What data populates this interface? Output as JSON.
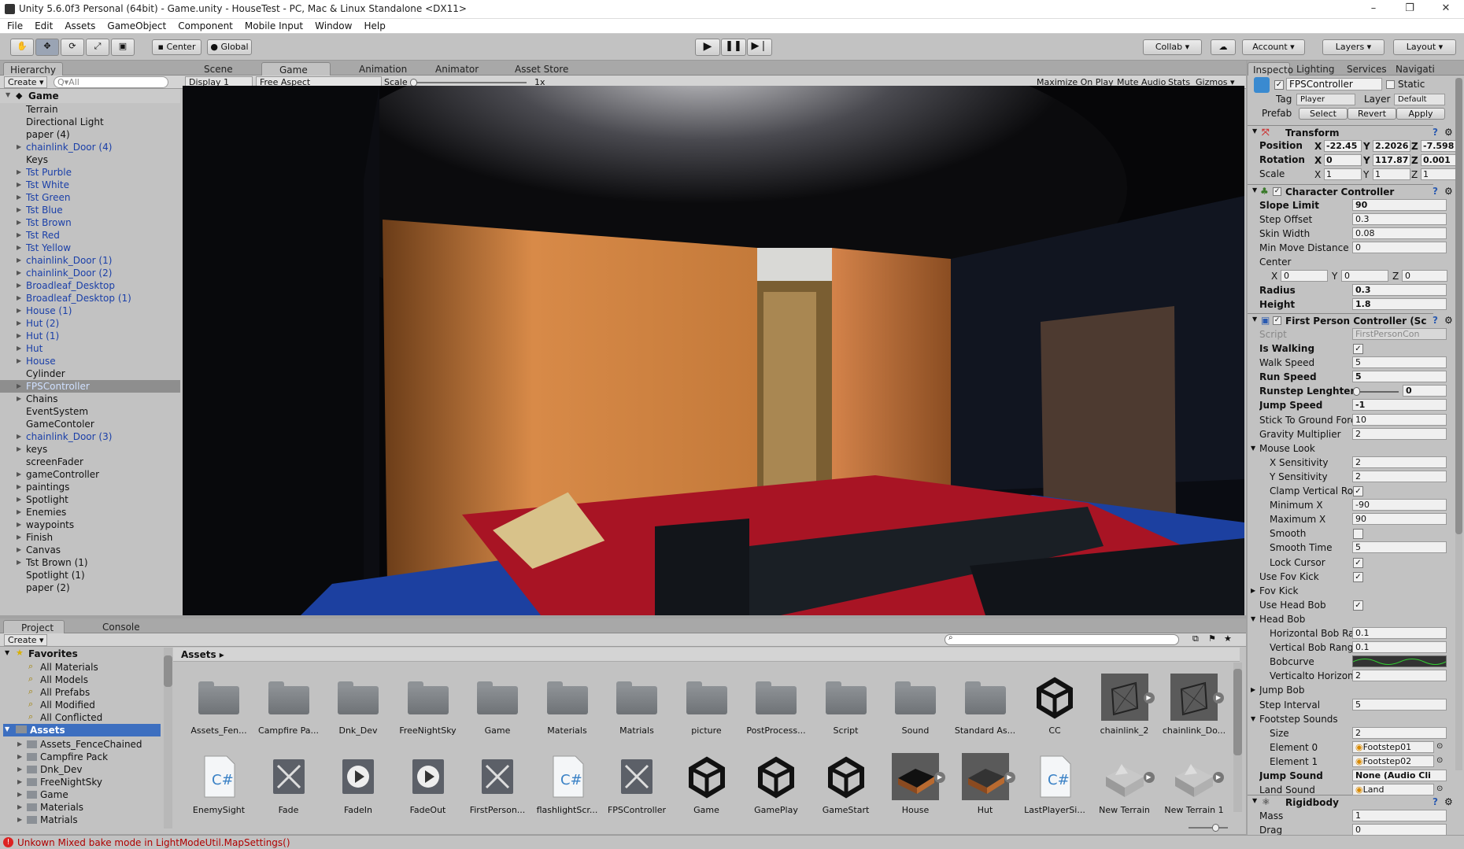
{
  "window": {
    "title": "Unity 5.6.0f3 Personal (64bit) - Game.unity - HouseTest - PC, Mac & Linux Standalone <DX11>",
    "min": "–",
    "max": "❐",
    "close": "✕"
  },
  "menu": [
    "File",
    "Edit",
    "Assets",
    "GameObject",
    "Component",
    "Mobile Input",
    "Window",
    "Help"
  ],
  "toolbar": {
    "center": "Center",
    "global": "Global",
    "collab": "Collab ▾",
    "account": "Account",
    "layers": "Layers",
    "layout": "Layout"
  },
  "hierarchy": {
    "tab": "Hierarchy",
    "create": "Create ▾",
    "search_placeholder": "Q▾All",
    "scene": "Game",
    "items": [
      {
        "label": "Terrain",
        "prefab": false,
        "arrow": false
      },
      {
        "label": "Directional Light",
        "prefab": false,
        "arrow": false
      },
      {
        "label": "paper (4)",
        "prefab": false,
        "arrow": false
      },
      {
        "label": "chainlink_Door (4)",
        "prefab": true,
        "arrow": true
      },
      {
        "label": "Keys",
        "prefab": false,
        "arrow": false
      },
      {
        "label": "Tst Purble",
        "prefab": true,
        "arrow": true
      },
      {
        "label": "Tst White",
        "prefab": true,
        "arrow": true
      },
      {
        "label": "Tst Green",
        "prefab": true,
        "arrow": true
      },
      {
        "label": "Tst Blue",
        "prefab": true,
        "arrow": true
      },
      {
        "label": "Tst Brown",
        "prefab": true,
        "arrow": true
      },
      {
        "label": "Tst Red",
        "prefab": true,
        "arrow": true
      },
      {
        "label": "Tst Yellow",
        "prefab": true,
        "arrow": true
      },
      {
        "label": "chainlink_Door (1)",
        "prefab": true,
        "arrow": true
      },
      {
        "label": "chainlink_Door (2)",
        "prefab": true,
        "arrow": true
      },
      {
        "label": "Broadleaf_Desktop",
        "prefab": true,
        "arrow": true
      },
      {
        "label": "Broadleaf_Desktop (1)",
        "prefab": true,
        "arrow": true
      },
      {
        "label": "House (1)",
        "prefab": true,
        "arrow": true
      },
      {
        "label": "Hut (2)",
        "prefab": true,
        "arrow": true
      },
      {
        "label": "Hut (1)",
        "prefab": true,
        "arrow": true
      },
      {
        "label": "Hut",
        "prefab": true,
        "arrow": true
      },
      {
        "label": "House",
        "prefab": true,
        "arrow": true
      },
      {
        "label": "Cylinder",
        "prefab": false,
        "arrow": false
      },
      {
        "label": "FPSController",
        "prefab": true,
        "arrow": true,
        "selected": true
      },
      {
        "label": "Chains",
        "prefab": false,
        "arrow": true
      },
      {
        "label": "EventSystem",
        "prefab": false,
        "arrow": false
      },
      {
        "label": "GameContoler",
        "prefab": false,
        "arrow": false
      },
      {
        "label": "chainlink_Door (3)",
        "prefab": true,
        "arrow": true
      },
      {
        "label": "keys",
        "prefab": false,
        "arrow": true
      },
      {
        "label": "screenFader",
        "prefab": false,
        "arrow": false
      },
      {
        "label": "gameController",
        "prefab": false,
        "arrow": true
      },
      {
        "label": "paintings",
        "prefab": false,
        "arrow": true
      },
      {
        "label": "Spotlight",
        "prefab": false,
        "arrow": true
      },
      {
        "label": "Enemies",
        "prefab": false,
        "arrow": true
      },
      {
        "label": "waypoints",
        "prefab": false,
        "arrow": true
      },
      {
        "label": "Finish",
        "prefab": false,
        "arrow": true
      },
      {
        "label": "Canvas",
        "prefab": false,
        "arrow": true
      },
      {
        "label": "Tst Brown (1)",
        "prefab": false,
        "arrow": true
      },
      {
        "label": "Spotlight (1)",
        "prefab": false,
        "arrow": false
      },
      {
        "label": "paper (2)",
        "prefab": false,
        "arrow": false
      }
    ]
  },
  "center_tabs": [
    "Scene",
    "Game",
    "Animation",
    "Animator",
    "Asset Store"
  ],
  "game_bar": {
    "display": "Display 1",
    "aspect": "Free Aspect",
    "scale_label": "Scale",
    "scale_value": "1x",
    "maximize": "Maximize On Play",
    "mute": "Mute Audio",
    "stats": "Stats",
    "gizmos": "Gizmos ▾"
  },
  "project": {
    "tabs": [
      "Project",
      "Console"
    ],
    "create": "Create ▾",
    "breadcrumb": "Assets ▸",
    "favorites_title": "Favorites",
    "favorites": [
      "All Materials",
      "All Models",
      "All Prefabs",
      "All Modified",
      "All Conflicted"
    ],
    "assets_root": "Assets",
    "tree": [
      "Assets_FenceChained",
      "Campfire Pack",
      "Dnk_Dev",
      "FreeNightSky",
      "Game",
      "Materials",
      "Matrials"
    ],
    "row1": [
      {
        "label": "Assets_Fen...",
        "kind": "folder"
      },
      {
        "label": "Campfire Pa...",
        "kind": "folder"
      },
      {
        "label": "Dnk_Dev",
        "kind": "folder"
      },
      {
        "label": "FreeNightSky",
        "kind": "folder"
      },
      {
        "label": "Game",
        "kind": "folder"
      },
      {
        "label": "Materials",
        "kind": "folder"
      },
      {
        "label": "Matrials",
        "kind": "folder"
      },
      {
        "label": "picture",
        "kind": "folder"
      },
      {
        "label": "PostProcess...",
        "kind": "folder"
      },
      {
        "label": "Script",
        "kind": "folder"
      },
      {
        "label": "Sound",
        "kind": "folder"
      },
      {
        "label": "Standard As...",
        "kind": "folder"
      },
      {
        "label": "CC",
        "kind": "unity"
      },
      {
        "label": "chainlink_2",
        "kind": "mesh"
      },
      {
        "label": "chainlink_Do...",
        "kind": "mesh"
      }
    ],
    "row2": [
      {
        "label": "EnemySight",
        "kind": "script"
      },
      {
        "label": "Fade",
        "kind": "anim"
      },
      {
        "label": "FadeIn",
        "kind": "clip"
      },
      {
        "label": "FadeOut",
        "kind": "clip"
      },
      {
        "label": "FirstPerson...",
        "kind": "anim"
      },
      {
        "label": "flashlightScr...",
        "kind": "script"
      },
      {
        "label": "FPSController",
        "kind": "anim"
      },
      {
        "label": "Game",
        "kind": "unity"
      },
      {
        "label": "GamePlay",
        "kind": "unity"
      },
      {
        "label": "GameStart",
        "kind": "unity"
      },
      {
        "label": "House",
        "kind": "house"
      },
      {
        "label": "Hut",
        "kind": "hut"
      },
      {
        "label": "LastPlayerSi...",
        "kind": "script"
      },
      {
        "label": "New Terrain",
        "kind": "terrain"
      },
      {
        "label": "New Terrain 1",
        "kind": "terrain"
      }
    ]
  },
  "inspector": {
    "tabs": [
      "Inspecto",
      "Lighting",
      "Services",
      "Navigati"
    ],
    "object": "FPSController",
    "static": "Static",
    "tag_label": "Tag",
    "tag": "Player",
    "layer_label": "Layer",
    "layer": "Default",
    "prefab_label": "Prefab",
    "select": "Select",
    "revert": "Revert",
    "apply": "Apply",
    "transform": {
      "title": "Transform",
      "position_label": "Position",
      "rotation_label": "Rotation",
      "scale_label": "Scale",
      "px": "-22.45",
      "py": "2.2026",
      "pz": "-7.598",
      "rx": "0",
      "ry": "117.87",
      "rz": "0.001",
      "sx": "1",
      "sy": "1",
      "sz": "1"
    },
    "cc": {
      "title": "Character Controller",
      "slope_label": "Slope Limit",
      "slope": "90",
      "step_label": "Step Offset",
      "step": "0.3",
      "skin_label": "Skin Width",
      "skin": "0.08",
      "minmove_label": "Min Move Distance",
      "minmove": "0",
      "center_label": "Center",
      "cx": "0",
      "cy": "0",
      "cz": "0",
      "radius_label": "Radius",
      "radius": "0.3",
      "height_label": "Height",
      "height": "1.8"
    },
    "fpc": {
      "title": "First Person Controller (Sc",
      "script_label": "Script",
      "script": "FirstPersonCon",
      "rows": [
        {
          "k": "Is Walking",
          "v": "✓",
          "type": "cb",
          "bold": true
        },
        {
          "k": "Walk Speed",
          "v": "5",
          "type": "v"
        },
        {
          "k": "Run Speed",
          "v": "5",
          "type": "v",
          "bold": true
        },
        {
          "k": "Runstep Lenghten",
          "v": "0",
          "type": "slider",
          "bold": true
        },
        {
          "k": "Jump Speed",
          "v": "-1",
          "type": "v",
          "bold": true
        },
        {
          "k": "Stick To Ground Forc",
          "v": "10",
          "type": "v"
        },
        {
          "k": "Gravity Multiplier",
          "v": "2",
          "type": "v"
        },
        {
          "k": "Mouse Look",
          "v": "",
          "type": "fold"
        },
        {
          "k": "X Sensitivity",
          "v": "2",
          "type": "v",
          "indent": true
        },
        {
          "k": "Y Sensitivity",
          "v": "2",
          "type": "v",
          "indent": true
        },
        {
          "k": "Clamp Vertical Ro",
          "v": "✓",
          "type": "cb",
          "indent": true
        },
        {
          "k": "Minimum X",
          "v": "-90",
          "type": "v",
          "indent": true
        },
        {
          "k": "Maximum X",
          "v": "90",
          "type": "v",
          "indent": true
        },
        {
          "k": "Smooth",
          "v": "",
          "type": "cb",
          "indent": true
        },
        {
          "k": "Smooth Time",
          "v": "5",
          "type": "v",
          "indent": true
        },
        {
          "k": "Lock Cursor",
          "v": "✓",
          "type": "cb",
          "indent": true
        },
        {
          "k": "Use Fov Kick",
          "v": "✓",
          "type": "cb"
        },
        {
          "k": "Fov Kick",
          "v": "",
          "type": "foldc"
        },
        {
          "k": "Use Head Bob",
          "v": "✓",
          "type": "cb"
        },
        {
          "k": "Head Bob",
          "v": "",
          "type": "fold"
        },
        {
          "k": "Horizontal Bob Ra",
          "v": "0.1",
          "type": "v",
          "indent": true
        },
        {
          "k": "Vertical Bob Rang",
          "v": "0.1",
          "type": "v",
          "indent": true
        },
        {
          "k": "Bobcurve",
          "v": "",
          "type": "curve",
          "indent": true
        },
        {
          "k": "Verticalto Horizon",
          "v": "2",
          "type": "v",
          "indent": true
        },
        {
          "k": "Jump Bob",
          "v": "",
          "type": "foldc"
        },
        {
          "k": "Step Interval",
          "v": "5",
          "type": "v"
        },
        {
          "k": "Footstep Sounds",
          "v": "",
          "type": "fold"
        },
        {
          "k": "Size",
          "v": "2",
          "type": "v",
          "indent": true
        },
        {
          "k": "Element 0",
          "v": "Footstep01",
          "type": "obj",
          "indent": true
        },
        {
          "k": "Element 1",
          "v": "Footstep02",
          "type": "obj",
          "indent": true
        },
        {
          "k": "Jump Sound",
          "v": "None (Audio Cli",
          "type": "v",
          "bold": true
        },
        {
          "k": "Land Sound",
          "v": "Land",
          "type": "obj"
        }
      ]
    },
    "rigidbody": {
      "title": "Rigidbody",
      "mass_label": "Mass",
      "mass": "1",
      "drag_label": "Drag",
      "drag": "0"
    }
  },
  "status": {
    "message": "Unkown Mixed bake mode in LightModeUtil.MapSettings()"
  }
}
